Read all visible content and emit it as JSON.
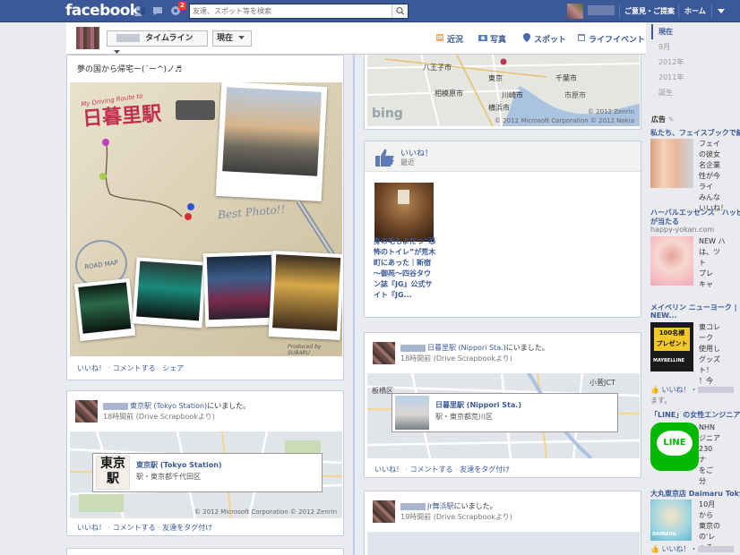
{
  "topbar": {
    "logo": "facebook",
    "notification_count": "2",
    "search_placeholder": "友達、スポット等を検索",
    "feedback_link": "ご意見・ご提案",
    "home_link": "ホーム"
  },
  "timeline_header": {
    "timeline_button": "タイムライン",
    "now_button": "現在",
    "nav": [
      "近況",
      "写真",
      "スポット",
      "ライフイベント"
    ]
  },
  "scrubber": [
    "現在",
    "9月",
    "2012年",
    "2011年",
    "誕生"
  ],
  "posts": {
    "first": {
      "status": "夢の国から帰宅ー(´ー^)ノ♬",
      "photo_text": {
        "brand": "My Driving Route to",
        "station": "日暮里駅",
        "best": "Best Photo!!",
        "roadmap": "ROAD MAP",
        "produced": "Produced by SUBARU"
      },
      "actions": [
        "いいね！",
        "コメントする",
        "シェア"
      ]
    },
    "tokyo": {
      "name_suffix": "東京駅 (Tokyo Station)",
      "checkin": "にいました。",
      "meta": "18時間前 (Drive Scrapbookより)",
      "place_title": "東京駅 (Tokyo Station)",
      "place_addr": "駅・東京都千代田区",
      "copyright": "© 2012 Microsoft Corporation © 2012 Zenrin",
      "actions": [
        "いいね！",
        "コメントする",
        "友達をタグ付け"
      ]
    },
    "map_top": {
      "labels": [
        "八王子市",
        "東京",
        "相模原市",
        "川崎市",
        "千葉市",
        "横浜市",
        "市原市"
      ],
      "copyright": "© 2012 Zenrin",
      "copyright2": "© 2012 Microsoft Corporation © 2012 Nokia",
      "bing": "bing"
    },
    "likes": {
      "title": "いいね！",
      "sub": "最近",
      "item_title": "身の毛もよだつ“恐怖のトイレ”が荒木町にあった｜新宿～御苑～四谷タウン誌『JG』公式サイト『JG..."
    },
    "nippori": {
      "name_suffix": "日暮里駅 (Nippori Sta.)",
      "checkin": "にいました。",
      "meta": "18時間前 (Drive Scrapbookより)",
      "place_title": "日暮里駅 (Nippori Sta.)",
      "place_addr": "駅・東京都荒川区",
      "map_labels": [
        "板橋区",
        "小菅JCT"
      ],
      "actions": [
        "いいね！",
        "コメントする",
        "友達をタグ付け"
      ]
    },
    "maihama": {
      "name_suffix": "Jr舞浜駅",
      "checkin": "にいました。",
      "meta": "19時間前 (Drive Scrapbookより)"
    }
  },
  "ads": {
    "label": "広告",
    "items": [
      {
        "title": "私たち、フェイスブックで結",
        "body": [
          "フェイ",
          "の彼女",
          "名企業",
          "性が今",
          "ライ",
          "みんな",
          "いいね！"
        ]
      },
      {
        "title": "ハーバルエッセンス　ハッピ",
        "title2": "が当たる",
        "url": "happy-yokan.com",
        "body": [
          "NEW ハ",
          "は、ツ",
          "ト",
          "プレ",
          "キャ"
        ]
      },
      {
        "title": "メイベリン ニューヨーク | NEW",
        "title2": "NEW...",
        "body": [
          "東コレ",
          "ーク",
          "使用し",
          "グッズ",
          "ト！",
          "！今"
        ],
        "img_text": [
          "100名様",
          "プレゼント",
          "MAYBELLINE"
        ],
        "like": "いいね！・",
        "like2": "ます。"
      },
      {
        "title": "「LINE」の女性エンジニア",
        "body": [
          "NHN",
          "ジニア",
          "230",
          "ナ",
          "をご",
          "分"
        ],
        "img_text": "LINE"
      },
      {
        "title": "大丸東京店 Daimaru Toky",
        "body": [
          "10月",
          "から",
          "東京の",
          "の'レ",
          "ゃる"
        ],
        "img_text": "DAIMARU",
        "like": "いいね！・"
      }
    ]
  },
  "colors": {
    "brand": "#3b5998",
    "link": "#3b5998",
    "background": "#e9ebee",
    "badge": "#f03d25",
    "line_green": "#00b900"
  }
}
